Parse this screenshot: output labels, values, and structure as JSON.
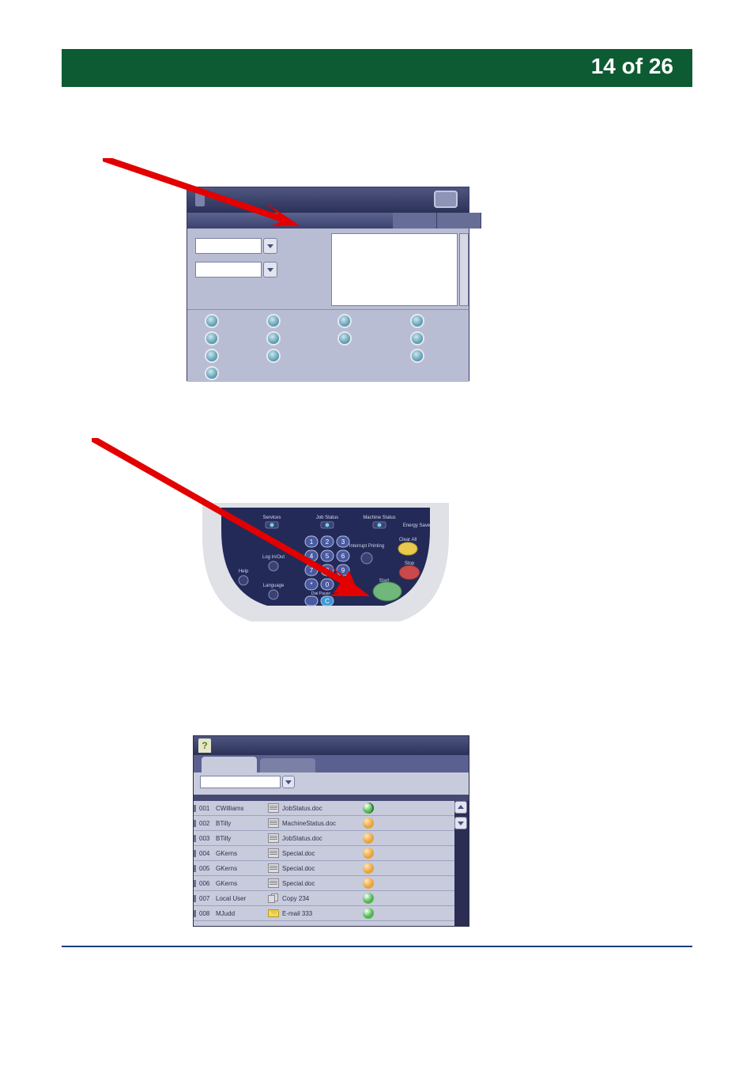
{
  "header": {
    "page_indicator": "14 of 26"
  },
  "fig1": {
    "topbar_icon": "services-home-icon"
  },
  "panel": {
    "labels": {
      "services": "Services",
      "job_status": "Job Status",
      "machine_status": "Machine Status",
      "energy_saver": "Energy Saver",
      "clear_all": "Clear All",
      "stop": "Stop",
      "interrupt": "Interrupt Printing",
      "start": "Start",
      "help": "Help",
      "language": "Language",
      "log_in_out": "Log In/Out",
      "dial_pause": "Dial Pause"
    },
    "keys": [
      "1",
      "2",
      "3",
      "4",
      "5",
      "6",
      "7",
      "8",
      "9",
      "*",
      "0",
      "C"
    ]
  },
  "joblist": {
    "help": "?",
    "rows": [
      {
        "num": "001",
        "owner": "CWilliams",
        "type": "doc",
        "doc": "JobStatus.doc",
        "status": "active"
      },
      {
        "num": "002",
        "owner": "BTilly",
        "type": "doc",
        "doc": "MachineStatus.doc",
        "status": "pending"
      },
      {
        "num": "003",
        "owner": "BTilly",
        "type": "doc",
        "doc": "JobStatus.doc",
        "status": "pending"
      },
      {
        "num": "004",
        "owner": "GKerns",
        "type": "doc",
        "doc": "Special.doc",
        "status": "pending"
      },
      {
        "num": "005",
        "owner": "GKerns",
        "type": "doc",
        "doc": "Special.doc",
        "status": "pending"
      },
      {
        "num": "006",
        "owner": "GKerns",
        "type": "doc",
        "doc": "Special.doc",
        "status": "pending"
      },
      {
        "num": "007",
        "owner": "Local User",
        "type": "copy",
        "doc": "Copy 234",
        "status": "done"
      },
      {
        "num": "008",
        "owner": "MJudd",
        "type": "mail",
        "doc": "E-mail 333",
        "status": "done"
      }
    ]
  }
}
